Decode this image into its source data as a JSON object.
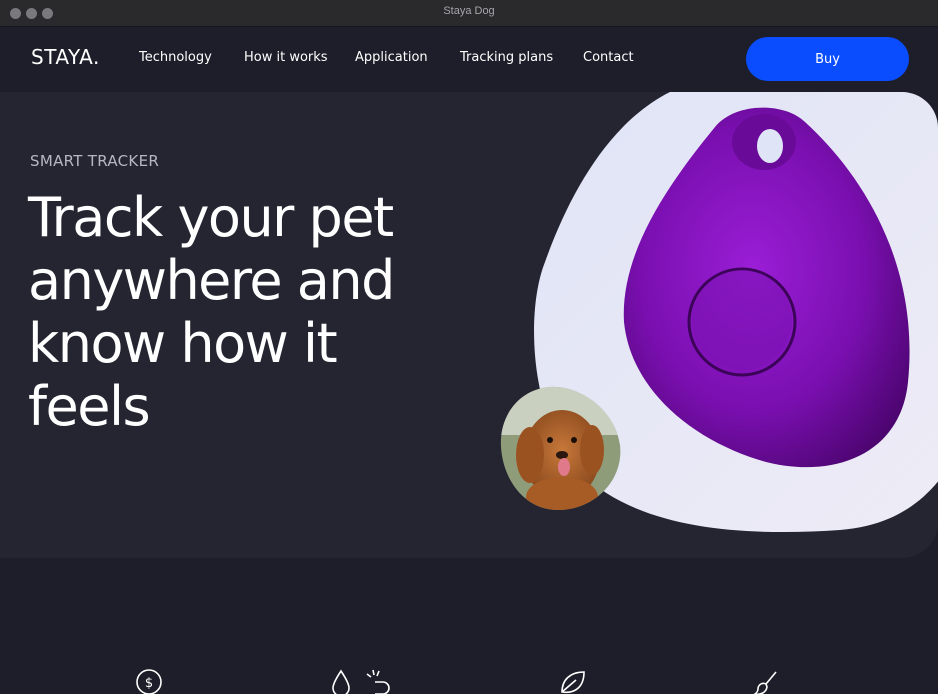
{
  "window": {
    "title": "Staya Dog"
  },
  "nav": {
    "logo": "STAYA.",
    "links": [
      "Technology",
      "How it works",
      "Application",
      "Tracking plans",
      "Contact"
    ],
    "buy_label": "Buy"
  },
  "hero": {
    "kicker": "SMART TRACKER",
    "headline": "Track your pet anywhere and know how it feels"
  },
  "features": {
    "icons": [
      "dollar-coin-icon",
      "water-drop-icon",
      "magnet-icon",
      "leaf-icon",
      "brush-icon"
    ]
  },
  "colors": {
    "background": "#1e1e2a",
    "hero_panel": "#252532",
    "accent": "#0a4dff",
    "tracker_purple": "#7a0fb0"
  }
}
